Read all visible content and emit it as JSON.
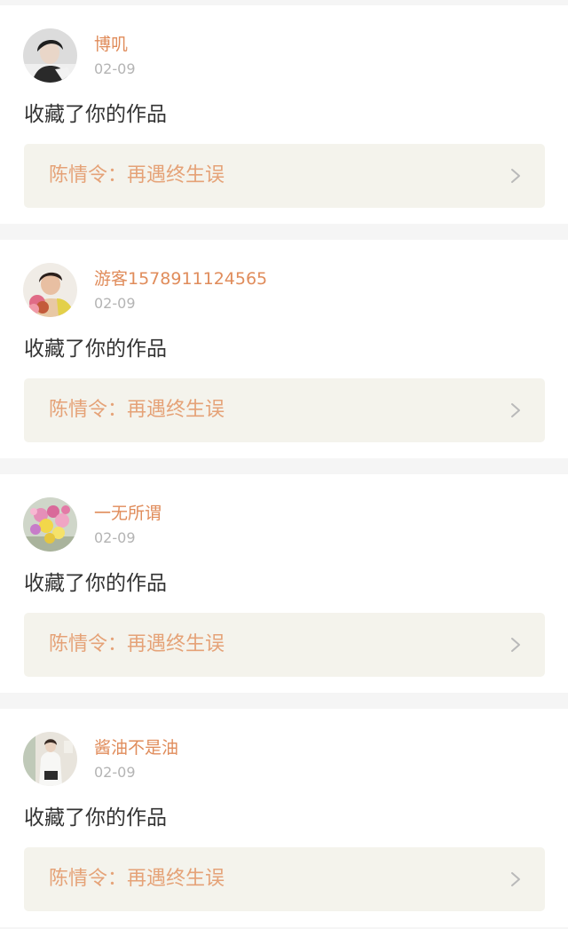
{
  "notifications": [
    {
      "avatar_icon": "person-dark-hair-icon",
      "username": "博叽",
      "date": "02-09",
      "action": "收藏了你的作品",
      "work_title": "陈情令：再遇终生误",
      "chevron_icon": "chevron-right-icon"
    },
    {
      "avatar_icon": "person-flowers-icon",
      "username": "游客1578911124565",
      "date": "02-09",
      "action": "收藏了你的作品",
      "work_title": "陈情令：再遇终生误",
      "chevron_icon": "chevron-right-icon"
    },
    {
      "avatar_icon": "flower-bouquet-icon",
      "username": "一无所谓",
      "date": "02-09",
      "action": "收藏了你的作品",
      "work_title": "陈情令：再遇终生误",
      "chevron_icon": "chevron-right-icon"
    },
    {
      "avatar_icon": "person-light-outfit-icon",
      "username": "酱油不是油",
      "date": "02-09",
      "action": "收藏了你的作品",
      "work_title": "陈情令：再遇终生误",
      "chevron_icon": "chevron-right-icon"
    }
  ],
  "colors": {
    "username": "#e08c5b",
    "date": "#b4b4b4",
    "action_text": "#333333",
    "work_title": "#e5a277",
    "work_bg": "#f4f3ec",
    "separator": "#f5f5f5"
  }
}
